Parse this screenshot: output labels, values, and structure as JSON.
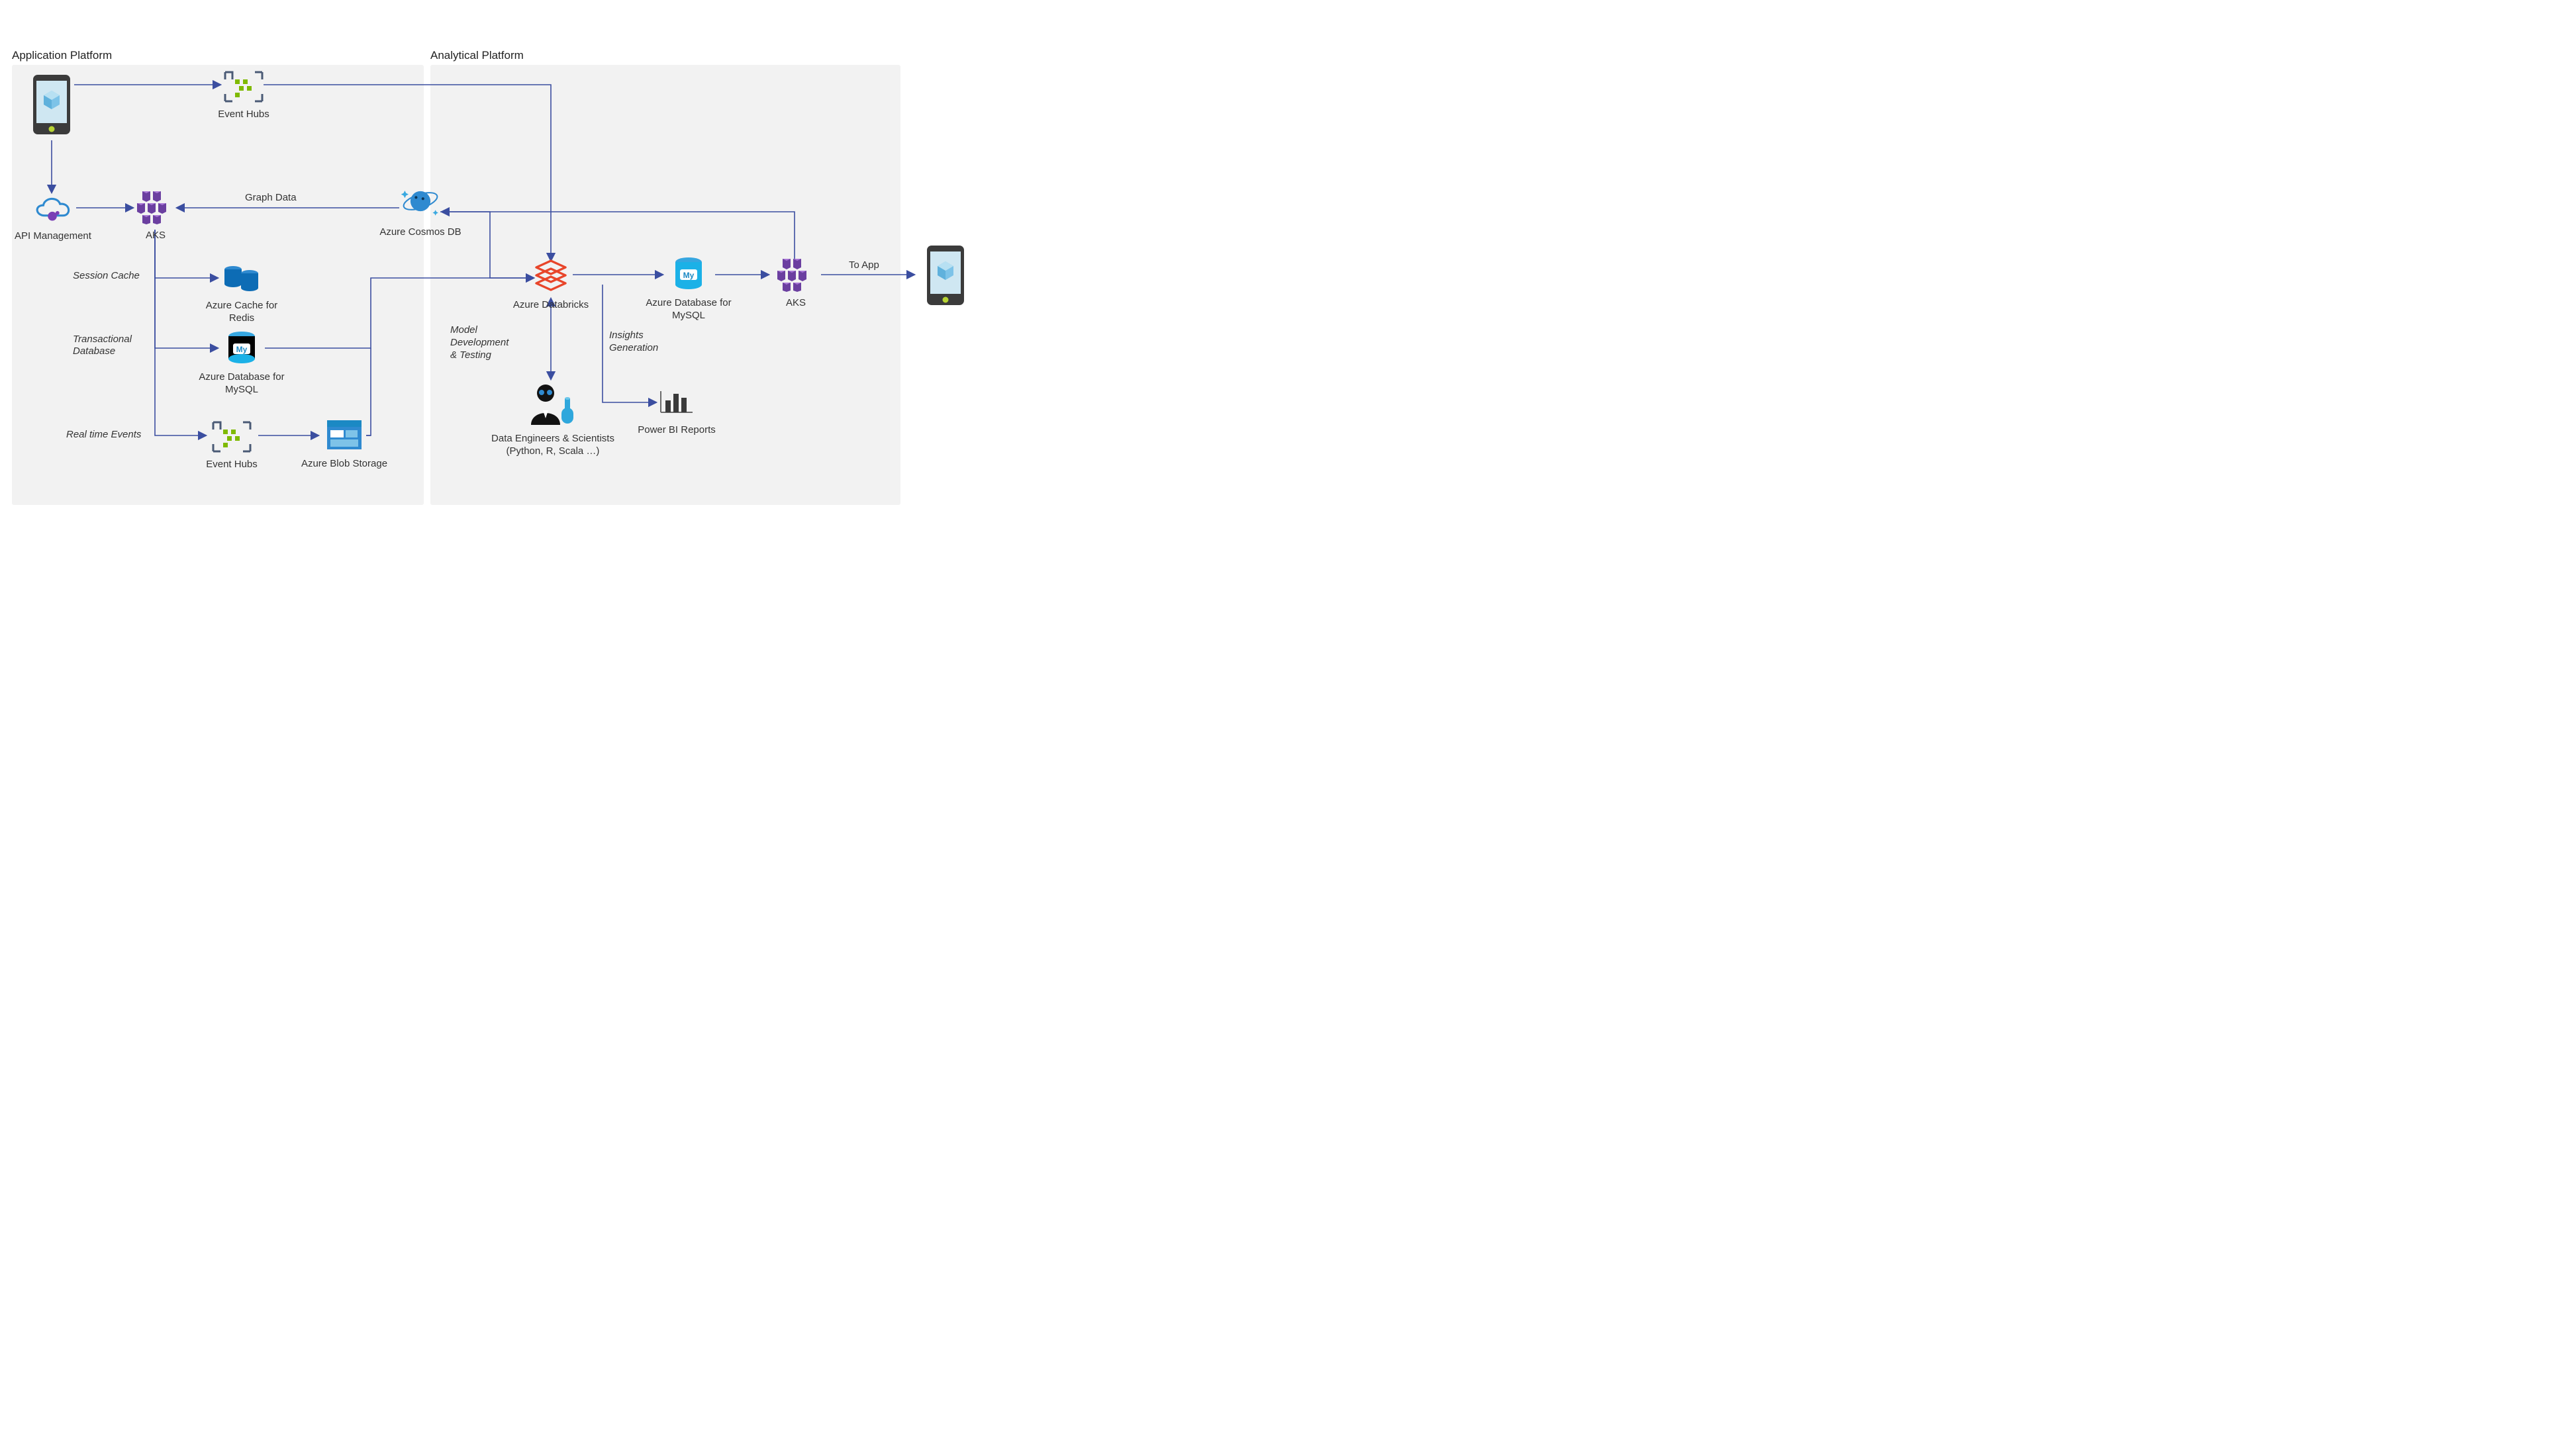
{
  "sections": {
    "app_platform": "Application Platform",
    "analytical_platform": "Analytical Platform"
  },
  "nodes": {
    "mobile_left": "",
    "mobile_right": "",
    "event_hubs_top": "Event Hubs",
    "api_mgmt": "API Management",
    "aks_left": "AKS",
    "cosmos": "Azure Cosmos DB",
    "redis": "Azure Cache for Redis",
    "mysql_left": "Azure Database for MySQL",
    "event_hubs_bottom": "Event Hubs",
    "blob": "Azure Blob Storage",
    "databricks": "Azure Databricks",
    "scientists_l1": "Data Engineers  & Scientists",
    "scientists_l2": "(Python, R, Scala …)",
    "mysql_right": "Azure Database for MySQL",
    "powerbi": "Power BI Reports",
    "aks_right": "AKS"
  },
  "edges": {
    "graph_data": "Graph Data",
    "session_cache": "Session Cache",
    "transactional_db_l1": "Transactional",
    "transactional_db_l2": "Database",
    "realtime_events": "Real time Events",
    "model_dev_l1": "Model",
    "model_dev_l2": "Development",
    "model_dev_l3": "& Testing",
    "insights_l1": "Insights",
    "insights_l2": "Generation",
    "to_app": "To App"
  }
}
